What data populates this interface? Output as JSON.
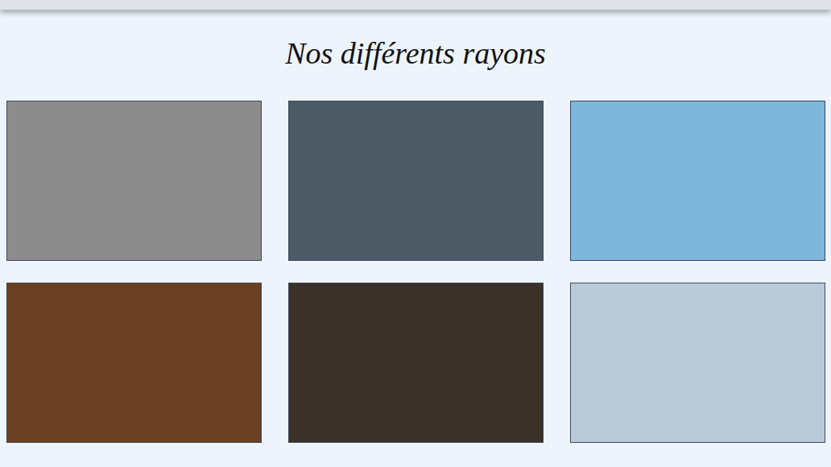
{
  "heading": "Nos différents rayons",
  "departments": [
    {
      "color": "#8c8c8c"
    },
    {
      "color": "#4d5a66"
    },
    {
      "color": "#7fb6dc"
    },
    {
      "color": "#6a3f22"
    },
    {
      "color": "#3b3128"
    },
    {
      "color": "#b9cbd9"
    }
  ]
}
